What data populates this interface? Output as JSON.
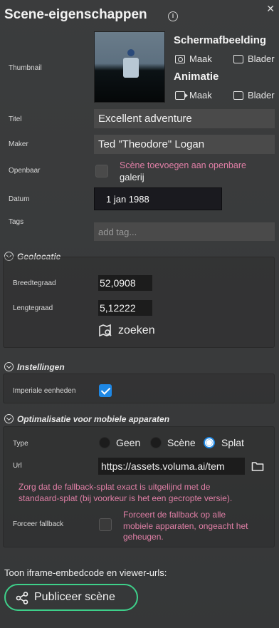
{
  "header": {
    "title": "Scene-eigenschappen",
    "close_glyph": "✕"
  },
  "thumbnail": {
    "label": "Thumbnail",
    "screenshot_heading": "Schermafbeelding",
    "screenshot_make": "Maak",
    "screenshot_browse": "Blader",
    "animation_heading": "Animatie",
    "animation_make": "Maak",
    "animation_browse": "Blader"
  },
  "fields": {
    "title_label": "Titel",
    "title_value": "Excellent adventure",
    "maker_label": "Maker",
    "maker_value": "Ted \"Theodore\" Logan",
    "public_label": "Openbaar",
    "public_hint_pink": "Scène toevoegen aan openbare",
    "public_hint_plain": "galerij",
    "date_label": "Datum",
    "date_value": "1 jan 1988",
    "tags_label": "Tags",
    "tags_placeholder": "add tag..."
  },
  "geolocation": {
    "heading": "Geolocatie",
    "lat_label": "Breedtegraad",
    "lat_value": "52,0908",
    "lon_label": "Lengtegraad",
    "lon_value": "5,12222",
    "search_label": "zoeken"
  },
  "settings": {
    "heading": "Instellingen",
    "imperial_label": "Imperiale eenheden",
    "imperial_checked": true
  },
  "mobile": {
    "heading": "Optimalisatie voor mobiele apparaten",
    "type_label": "Type",
    "options": [
      "Geen",
      "Scène",
      "Splat"
    ],
    "selected": "Splat",
    "url_label": "Url",
    "url_value": "https://assets.voluma.ai/tem",
    "url_warning_line1": "Zorg dat de fallback-splat exact is uitgelijnd met de",
    "url_warning_line2": "standaard-splat (bij voorkeur is het een gecropte versie).",
    "force_label": "Forceer fallback",
    "force_hint_line1": "Forceert de fallback op alle",
    "force_hint_line2": "mobiele apparaten, ongeacht het",
    "force_hint_line3": "geheugen."
  },
  "footer": {
    "embed_text": "Toon iframe-embedcode en viewer-urls:",
    "publish_label": "Publiceer scène"
  },
  "colors": {
    "accent_blue": "#1e88e5",
    "publish_green": "#3ed08a",
    "hint_pink": "#e07fa6"
  }
}
